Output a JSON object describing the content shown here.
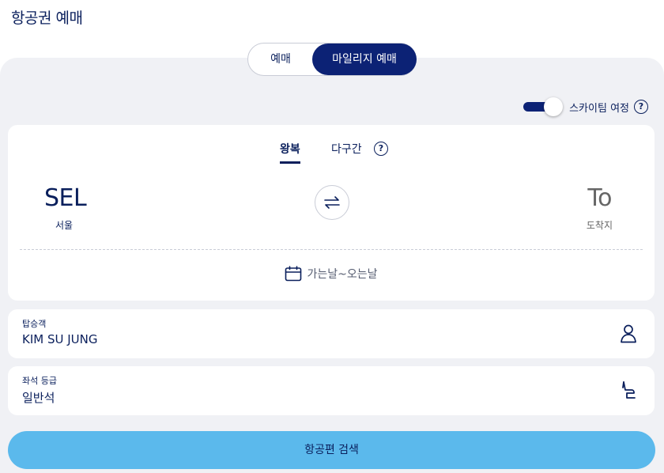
{
  "page": {
    "title": "항공권 예매"
  },
  "booking_mode": {
    "options": [
      "예매",
      "마일리지 예매"
    ],
    "selected": "마일리지 예매"
  },
  "skytime": {
    "label": "스카이팀 여정",
    "enabled": true
  },
  "trip_type": {
    "roundtrip_label": "왕복",
    "multi_label": "다구간",
    "selected": "왕복"
  },
  "route": {
    "from_code": "SEL",
    "from_name": "서울",
    "to_code": "To",
    "to_name": "도착지"
  },
  "dates": {
    "label": "가는날~오는날"
  },
  "passengers": {
    "label": "탑승객",
    "value": "KIM SU JUNG"
  },
  "seat_class": {
    "label": "좌석 등급",
    "value": "일반석"
  },
  "search": {
    "label": "항공편 검색"
  },
  "colors": {
    "navy": "#0c2275",
    "accent": "#5bb9ec",
    "panel_bg": "#f0f1f5"
  },
  "icons": {
    "help": "?",
    "swap": "swap-arrows-icon",
    "calendar": "calendar-icon",
    "person": "person-icon",
    "seat": "seat-icon"
  }
}
